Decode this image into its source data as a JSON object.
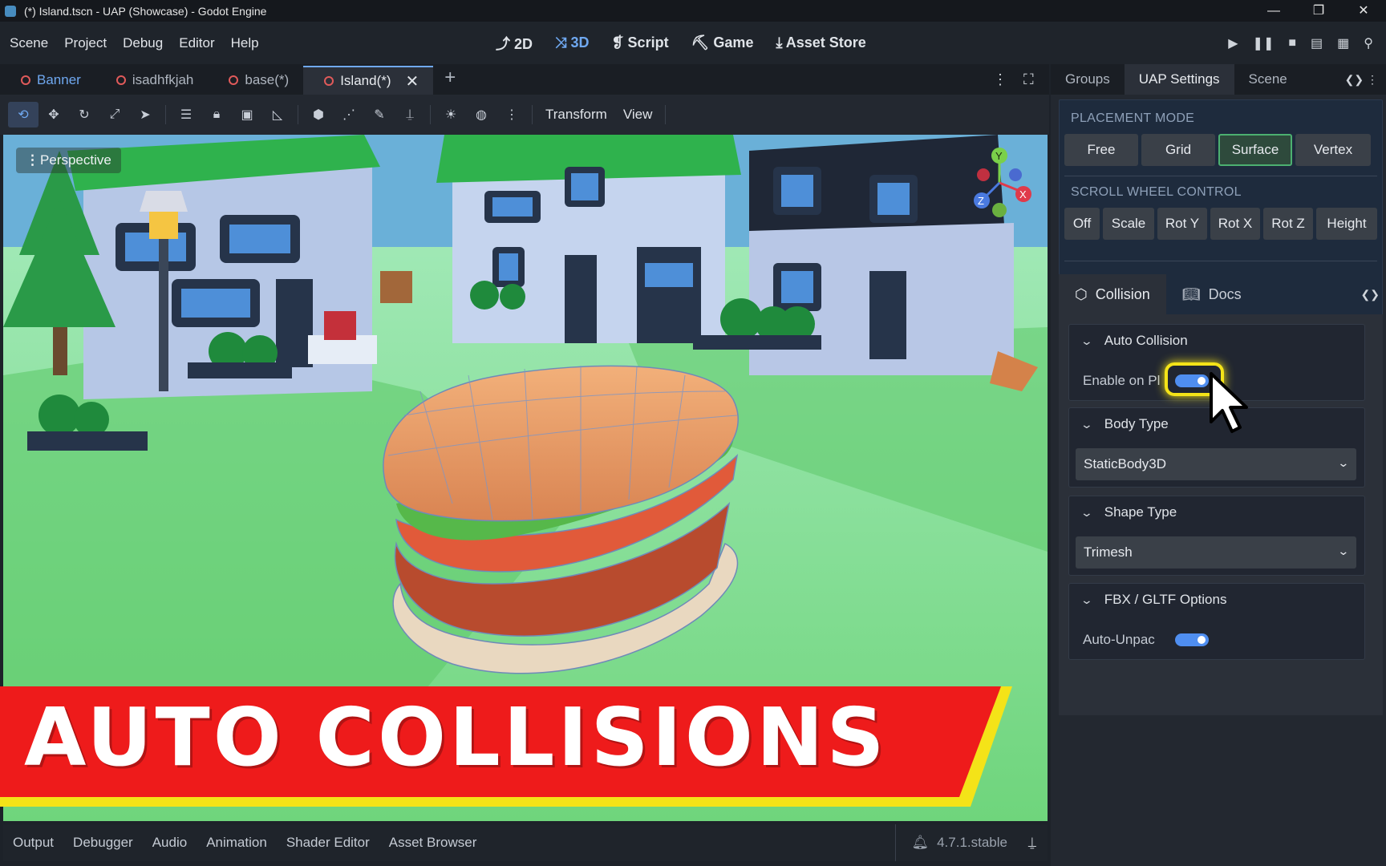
{
  "window": {
    "title": "(*) Island.tscn - UAP (Showcase) - Godot Engine",
    "controls": [
      "—",
      "❐",
      "✕"
    ]
  },
  "menubar": {
    "menus": [
      "Scene",
      "Project",
      "Debug",
      "Editor",
      "Help"
    ],
    "workspaces": [
      {
        "icon": "2d-icon",
        "label": "2D"
      },
      {
        "icon": "3d-icon",
        "label": "3D",
        "active": true
      },
      {
        "icon": "script-icon",
        "label": "Script"
      },
      {
        "icon": "game-icon",
        "label": "Game"
      },
      {
        "icon": "asset-store-icon",
        "label": "Asset Store"
      }
    ]
  },
  "scene_tabs": {
    "tabs": [
      "Banner",
      "isadhfkjah",
      "base(*)",
      "Island(*)"
    ],
    "active_index": 3
  },
  "toolbar3d": {
    "transform_label": "Transform",
    "view_label": "View"
  },
  "viewport": {
    "perspective_label": "Perspective",
    "gizmo_axes": [
      "Y",
      "Z",
      "X"
    ]
  },
  "banner": {
    "text": "AUTO COLLISIONS",
    "colors": {
      "fill": "#ee1b1b",
      "stroke": "#f4e318"
    }
  },
  "bottom_panel": {
    "tabs": [
      "Output",
      "Debugger",
      "Audio",
      "Animation",
      "Shader Editor",
      "Asset Browser"
    ],
    "version": "4.7.1.stable"
  },
  "right_dock": {
    "tabs": [
      "Groups",
      "UAP Settings",
      "Scene"
    ],
    "active_index": 1,
    "placement_mode": {
      "label": "PLACEMENT MODE",
      "options": [
        "Free",
        "Grid",
        "Surface",
        "Vertex"
      ],
      "selected": "Surface"
    },
    "scroll_wheel": {
      "label": "SCROLL WHEEL CONTROL",
      "options": [
        "Off",
        "Scale",
        "Rot Y",
        "Rot X",
        "Rot Z",
        "Height"
      ]
    },
    "subtabs": [
      "Collision",
      "Docs"
    ],
    "auto_collision": {
      "title": "Auto Collision",
      "enable_label": "Enable on Pl",
      "enabled": true
    },
    "body_type": {
      "title": "Body Type",
      "value": "StaticBody3D"
    },
    "shape_type": {
      "title": "Shape Type",
      "value": "Trimesh"
    },
    "fbx_options": {
      "title": "FBX / GLTF Options",
      "auto_unpack_label": "Auto-Unpac",
      "enabled": true
    }
  },
  "colors": {
    "accent": "#6fa8f0",
    "selected_mode": "#4cb070",
    "highlight": "#f4e318",
    "toggle": "#4f8ef0"
  }
}
